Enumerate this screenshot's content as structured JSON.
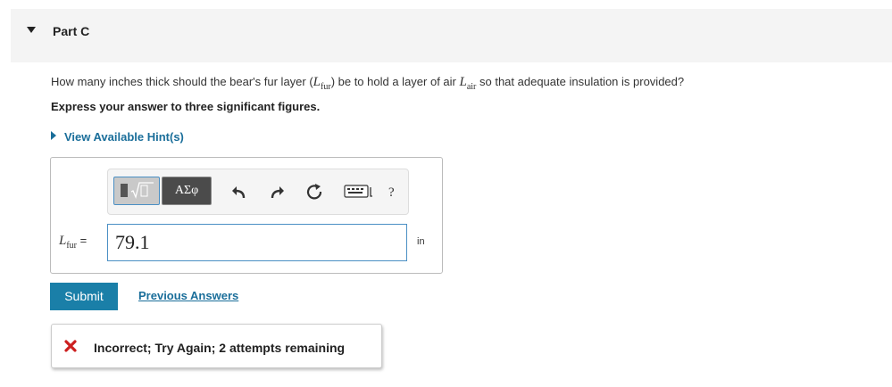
{
  "part": {
    "title": "Part C"
  },
  "question": {
    "prefix": "How many inches thick should the bear's fur layer (",
    "var1_symbol": "L",
    "var1_sub": "fur",
    "middle": ") be to hold a layer of air ",
    "var2_symbol": "L",
    "var2_sub": "air",
    "suffix": " so that adequate insulation is provided?"
  },
  "instruction": "Express your answer to three significant figures.",
  "hint": {
    "label": "View Available Hint(s)"
  },
  "toolbar": {
    "greek_label": "ΑΣφ",
    "help_label": "?",
    "icons": [
      "templates-icon",
      "greek-symbols",
      "undo-icon",
      "redo-icon",
      "reset-icon",
      "keyboard-icon",
      "help-icon"
    ]
  },
  "answer": {
    "var_symbol": "L",
    "var_sub": "fur",
    "equals": "=",
    "value": "79.1",
    "unit": "in"
  },
  "actions": {
    "submit_label": "Submit",
    "previous_answers_label": "Previous Answers"
  },
  "feedback": {
    "text": "Incorrect; Try Again; 2 attempts remaining",
    "status_color": "#cc1f1f"
  },
  "colors": {
    "accent": "#1a7fa8",
    "link": "#1a6e9a",
    "header_band": "#f4f4f4"
  }
}
